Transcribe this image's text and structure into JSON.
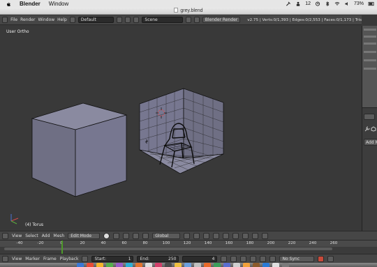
{
  "macos": {
    "app_name": "Blender",
    "menu_window": "Window",
    "status_number": "12",
    "battery": "73%"
  },
  "window": {
    "title": "grey.blend"
  },
  "info_header": {
    "menus": [
      "File",
      "Render",
      "Window",
      "Help"
    ],
    "layout_name": "Default",
    "scene_name": "Scene",
    "render_engine": "Blender Render",
    "stats": "v2.75 | Verts:0/1,393 | Edges:0/2,553 | Faces:0/1,173 | Tris"
  },
  "viewport": {
    "view_label": "User Ortho",
    "object_label": "(4) Torus"
  },
  "right_panel": {
    "add_button": "Add M"
  },
  "view_header": {
    "menus": [
      "View",
      "Select",
      "Add",
      "Mesh"
    ],
    "mode": "Edit Mode",
    "orientation": "Global"
  },
  "timeline": {
    "ticks": [
      "-40",
      "-20",
      "0",
      "20",
      "40",
      "60",
      "80",
      "100",
      "120",
      "140",
      "160",
      "180",
      "200",
      "220",
      "240",
      "260"
    ],
    "current_frame": "4"
  },
  "timeline_header": {
    "menus": [
      "View",
      "Marker",
      "Frame",
      "Playback"
    ],
    "start_label": "Start:",
    "start_value": "1",
    "end_label": "End:",
    "end_value": "250",
    "frame_value": "4",
    "sync": "No Sync"
  },
  "colors": {
    "viewport_bg": "#393939",
    "header_bg": "#464646",
    "playhead": "#4e9a2a",
    "cube_face": "#7b7b90"
  }
}
